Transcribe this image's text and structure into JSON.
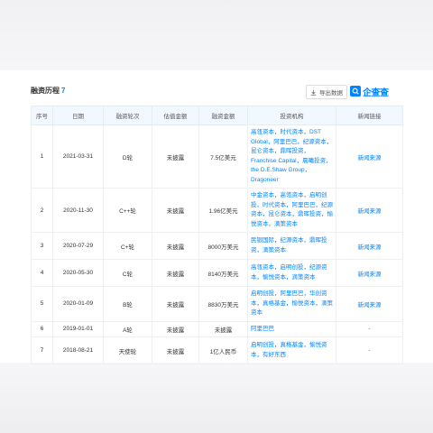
{
  "section": {
    "title": "融资历程",
    "count": "7",
    "export_label": "导出数据",
    "brand": "企查查"
  },
  "columns": [
    "序号",
    "日期",
    "融资轮次",
    "估值金额",
    "融资金额",
    "投资机构",
    "新闻链接"
  ],
  "rows": [
    {
      "no": "1",
      "date": "2021-03-31",
      "round": "D轮",
      "valuation": "未披露",
      "amount": "7.5亿美元",
      "investors": "高瓴资本，时代资本，DST Global，阿里巴巴，纪源资本，昆仑资本，鼎晖投资，Franchise Capital，晨曦投资，the D.E.Shaw Group，Dragoneer",
      "news": "新闻来源"
    },
    {
      "no": "2",
      "date": "2020-11-30",
      "round": "C++轮",
      "valuation": "未披露",
      "amount": "1.96亿美元",
      "investors": "中金资本，高瓴资本，启明创投，时代资本，阿里巴巴，纪源资本，昆仑资本，鼎晖投资，愉悦资本，滴策资本",
      "news": "新闻来源"
    },
    {
      "no": "3",
      "date": "2020-07-29",
      "round": "C+轮",
      "valuation": "未披露",
      "amount": "8000万美元",
      "investors": "民银国际，纪源资本，鼎晖投资，滴策资本",
      "news": "新闻来源"
    },
    {
      "no": "4",
      "date": "2020-05-30",
      "round": "C轮",
      "valuation": "未披露",
      "amount": "8140万美元",
      "investors": "高瓴资本，启明创投，纪源资本，愉悦资本，滴策资本",
      "news": "新闻来源"
    },
    {
      "no": "5",
      "date": "2020-01-09",
      "round": "B轮",
      "valuation": "未披露",
      "amount": "8830万美元",
      "investors": "启明创投，阿里巴巴，华创资本，真格基金，愉悦资本，滴策资本",
      "news": "新闻来源"
    },
    {
      "no": "6",
      "date": "2019-01-01",
      "round": "A轮",
      "valuation": "未披露",
      "amount": "未披露",
      "investors": "阿里巴巴",
      "news": "-"
    },
    {
      "no": "7",
      "date": "2018-08-21",
      "round": "天使轮",
      "valuation": "未披露",
      "amount": "1亿人民币",
      "investors": "启明创投，真格基金，愉悦资本，有好东西",
      "news": "-"
    }
  ]
}
